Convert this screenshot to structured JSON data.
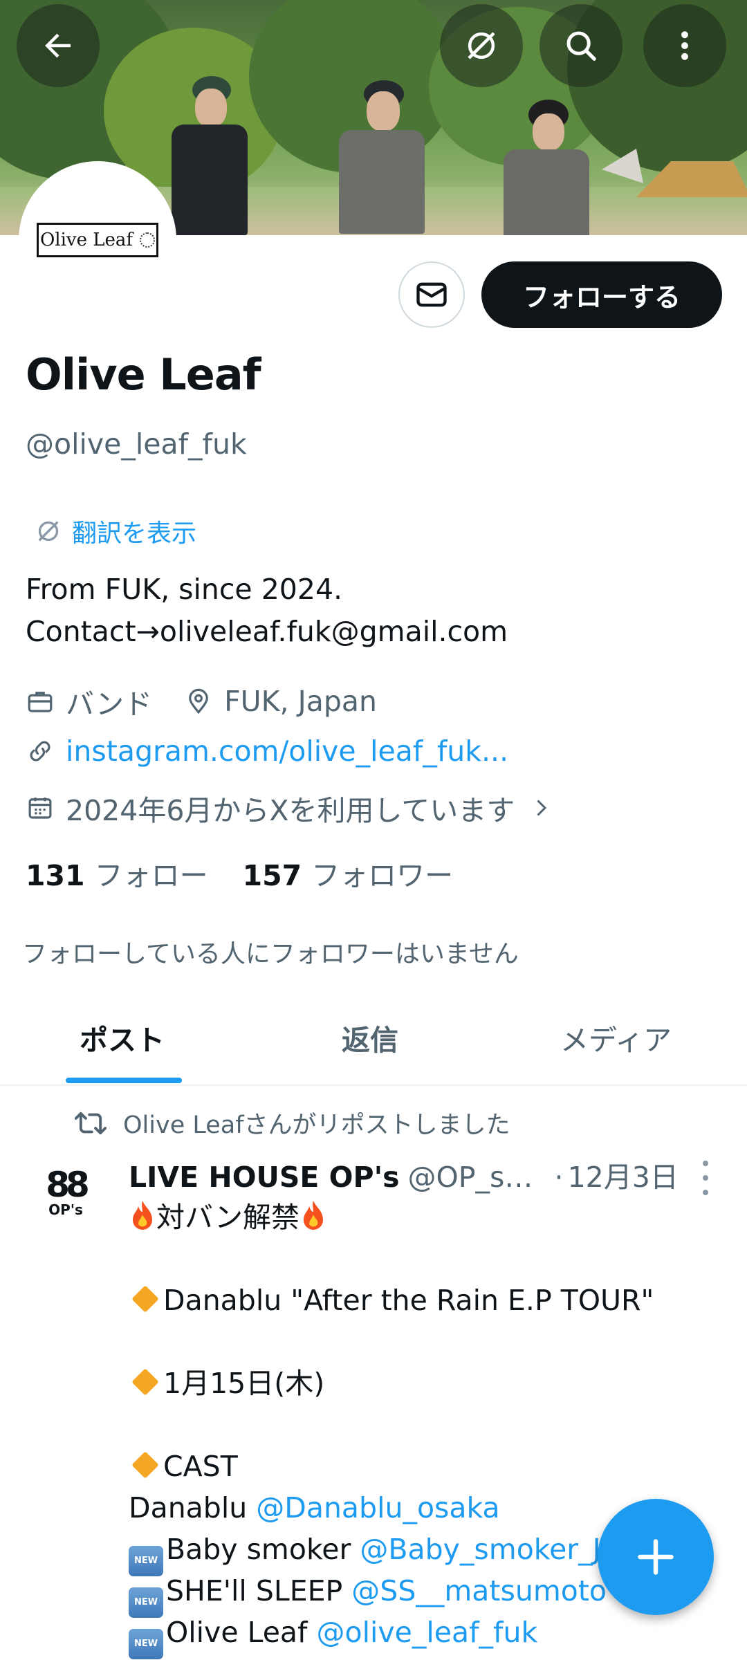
{
  "profile": {
    "avatar_text": "Olive Leaf",
    "name": "Olive Leaf",
    "handle": "@olive_leaf_fuk",
    "translate_label": "翻訳を表示",
    "bio_line1": "From FUK, since 2024.",
    "bio_line2": "Contact→oliveleaf.fuk@gmail.com",
    "category": "バンド",
    "location": "FUK, Japan",
    "website": "instagram.com/olive_leaf_fuk...",
    "joined": "2024年6月からXを利用しています",
    "following_count": "131",
    "following_label": "フォロー",
    "followers_count": "157",
    "followers_label": "フォロワー",
    "mutuals_note": "フォローしている人にフォロワーはいません"
  },
  "actions": {
    "follow_label": "フォローする"
  },
  "tabs": [
    {
      "label": "ポスト",
      "active": true
    },
    {
      "label": "返信",
      "active": false
    },
    {
      "label": "メディア",
      "active": false
    }
  ],
  "post": {
    "repost_note": "Olive Leafさんがリポストしました",
    "avatar_text": "OP's",
    "author": "LIVE HOUSE OP's",
    "handle": "@OP_s_f...",
    "dot": "·",
    "date": "12月3日",
    "line1": "対バン解禁",
    "line2": "Danablu \"After the Rain E.P TOUR\"",
    "line3": "1月15日(木)",
    "line4": "CAST",
    "line5_text": "Danablu ",
    "line5_mention": "@Danablu_osaka",
    "line6_text": "Baby smoker ",
    "line6_mention": "@Baby_smoker_JP",
    "line7_text": "SHE'll SLEEP ",
    "line7_mention": "@SS__matsumoto",
    "line8_text": "Olive Leaf ",
    "line8_mention": "@olive_leaf_fuk",
    "new_badge": "NEW"
  },
  "colors": {
    "accent": "#1d9bf0",
    "text": "#0f1419",
    "muted": "#536471",
    "follow_bg": "#0f1419"
  },
  "icons": [
    "back-arrow-icon",
    "translate-icon",
    "search-icon",
    "more-vertical-icon",
    "mail-icon",
    "briefcase-icon",
    "location-pin-icon",
    "link-icon",
    "calendar-icon",
    "chevron-right-icon",
    "repost-icon",
    "plus-icon"
  ]
}
